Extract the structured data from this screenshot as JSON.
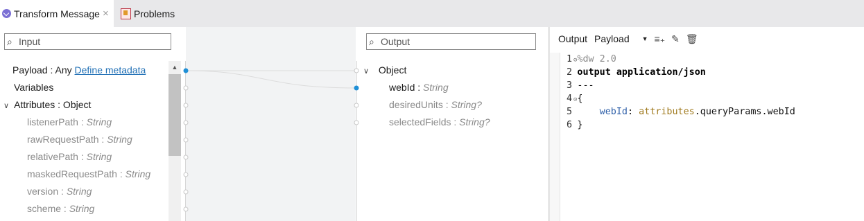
{
  "tabs": {
    "transform_label": "Transform Message",
    "problems_label": "Problems",
    "close_glyph": "×"
  },
  "input_panel": {
    "search_placeholder": "Input",
    "payload_label": "Payload : Any",
    "define_metadata": "Define metadata",
    "variables_label": "Variables",
    "attributes_label": "Attributes : Object",
    "fields": [
      {
        "name": "listenerPath",
        "type": "String"
      },
      {
        "name": "rawRequestPath",
        "type": "String"
      },
      {
        "name": "relativePath",
        "type": "String"
      },
      {
        "name": "maskedRequestPath",
        "type": "String"
      },
      {
        "name": "version",
        "type": "String"
      },
      {
        "name": "scheme",
        "type": "String"
      }
    ]
  },
  "output_panel": {
    "search_placeholder": "Output",
    "root_label": "Object",
    "fields": [
      {
        "name": "webId",
        "type": "String",
        "mapped": true
      },
      {
        "name": "desiredUnits",
        "type": "String?",
        "mapped": false
      },
      {
        "name": "selectedFields",
        "type": "String?",
        "mapped": false
      }
    ]
  },
  "code_panel": {
    "output_label": "Output",
    "target_select": "Payload",
    "lines": [
      {
        "num": "1",
        "text": "%dw 2.0"
      },
      {
        "num": "2",
        "text": "output application/json"
      },
      {
        "num": "3",
        "text": "---"
      },
      {
        "num": "4",
        "text": "{"
      },
      {
        "num": "5",
        "indent": "    ",
        "key": "webId",
        "sep": ": ",
        "obj": "attributes",
        "rest": ".queryParams.webId"
      },
      {
        "num": "6",
        "text": "}"
      }
    ]
  },
  "icons": {
    "search": "search-icon",
    "chevron_down": "chevron-down-icon",
    "add_row": "add-row-icon",
    "edit": "pencil-icon",
    "delete": "trash-icon"
  },
  "colors": {
    "mapping_dot": "#1f8fd6",
    "link": "#1f6fb5",
    "keyword": "#000000",
    "field_key": "#2e5fa8",
    "attributes_ref": "#a07a1e"
  }
}
